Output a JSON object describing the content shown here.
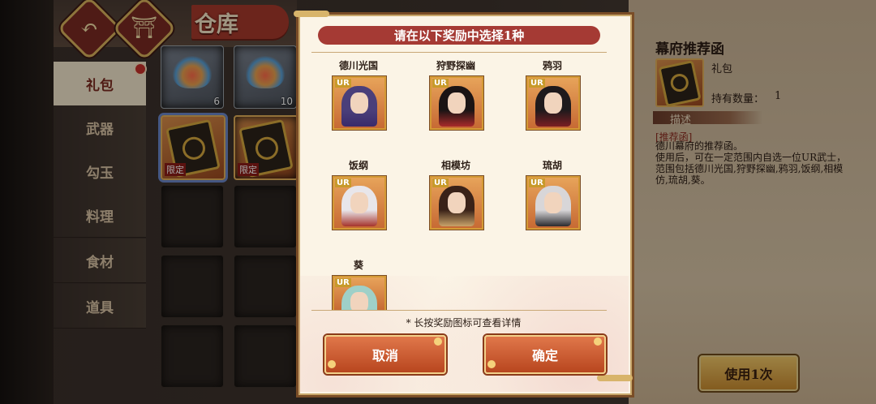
{
  "header": {
    "title": "仓库",
    "back_icon": "back-arrow-icon",
    "home_icon": "torii-gate-icon"
  },
  "sidebar": {
    "items": [
      {
        "label": "礼包",
        "active": true,
        "has_badge": true
      },
      {
        "label": "武器"
      },
      {
        "label": "勾玉"
      },
      {
        "label": "料理"
      },
      {
        "label": "食材"
      },
      {
        "label": "道具"
      }
    ]
  },
  "grid": {
    "items": [
      {
        "kind": "fire-mask",
        "count": "6"
      },
      {
        "kind": "fire-mask",
        "count": "10"
      },
      {
        "kind": "gift",
        "tag": "限定",
        "selected": true
      },
      {
        "kind": "gift",
        "tag": "限定"
      }
    ]
  },
  "detail": {
    "title": "幕府推荐函",
    "type": "礼包",
    "hold_label": "持有数量：",
    "hold_value": "1",
    "desc_label": "描述",
    "desc_head": "[推荐函]",
    "desc_body": "德川幕府的推荐函。\n使用后，可在一定范围内自选一位UR武士，范围包括德川光国,狩野探幽,鸦羽,饭纲,相模仿,琉胡,葵。",
    "use_button": "使用1次"
  },
  "modal": {
    "header": "请在以下奖励中选择1种",
    "rewards": [
      {
        "name": "德川光国",
        "rarity": "UR",
        "hair": "#4a3f7a",
        "robe": "#3a2a6a"
      },
      {
        "name": "狩野探幽",
        "rarity": "UR",
        "hair": "#1b1414",
        "robe": "#a82a2a"
      },
      {
        "name": "鸦羽",
        "rarity": "UR",
        "hair": "#1f1a1c",
        "robe": "#7a1e22"
      },
      {
        "name": "饭纲",
        "rarity": "UR",
        "hair": "#e8e6ea",
        "robe": "#a5342c"
      },
      {
        "name": "相模坊",
        "rarity": "UR",
        "hair": "#3a2218",
        "robe": "#c9a36a"
      },
      {
        "name": "琉胡",
        "rarity": "UR",
        "hair": "#d8d6d8",
        "robe": "#2a2a2e"
      },
      {
        "name": "葵",
        "rarity": "UR",
        "hair": "#9fd0c8",
        "robe": "#4f8aa8"
      }
    ],
    "note": "* 长按奖励图标可查看详情",
    "cancel": "取消",
    "confirm": "确定"
  }
}
